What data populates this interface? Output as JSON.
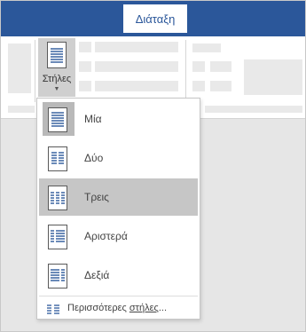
{
  "ribbon": {
    "active_tab": "Διάταξη",
    "columns_button_label": "Στήλες"
  },
  "columns_menu": {
    "items": [
      {
        "label": "Μία",
        "icon": "one-column-icon",
        "selected": false
      },
      {
        "label": "Δύο",
        "icon": "two-columns-icon",
        "selected": false
      },
      {
        "label": "Τρεις",
        "icon": "three-columns-icon",
        "selected": true
      },
      {
        "label": "Αριστερά",
        "icon": "left-column-icon",
        "selected": false
      },
      {
        "label": "Δεξιά",
        "icon": "right-column-icon",
        "selected": false
      }
    ],
    "more_prefix": "Περισσότερες ",
    "more_underlined": "στήλες",
    "more_suffix": "..."
  },
  "colors": {
    "title_bar": "#2b579a",
    "highlight": "#c6c6c6",
    "icon_blue": "#2b579a"
  }
}
